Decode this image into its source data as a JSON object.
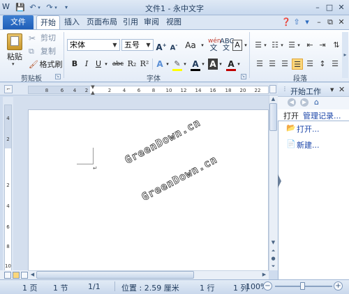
{
  "window": {
    "title": "文件1 - 永中文字",
    "app_icon_letter": "W"
  },
  "quick_access": {
    "save_icon": "save-icon",
    "undo_icon": "undo-icon",
    "redo_icon": "redo-icon"
  },
  "tabs": {
    "file": "文件",
    "items": [
      "开始",
      "插入",
      "页面布局",
      "引用",
      "审阅",
      "视图"
    ],
    "active": "开始"
  },
  "clipboard": {
    "paste_label": "粘贴",
    "cut_label": "剪切",
    "copy_label": "复制",
    "format_painter_label": "格式刷",
    "group_label": "剪贴板"
  },
  "font": {
    "font_name": "宋体",
    "font_size": "五号",
    "group_label": "字体",
    "aa_label": "Aa",
    "bold": "B",
    "italic": "I",
    "underline": "U",
    "strike": "abc",
    "subscript": "R₂",
    "superscript": "R²",
    "color_a": "A"
  },
  "paragraph": {
    "group_label": "段落"
  },
  "ruler": {
    "ticks": [
      "8",
      "6",
      "4",
      "2",
      "",
      "2",
      "4",
      "6",
      "8",
      "10",
      "12",
      "14",
      "16",
      "18",
      "20",
      "22"
    ],
    "vticks": [
      "4",
      "2",
      "",
      "2",
      "4",
      "6",
      "8",
      "10"
    ]
  },
  "watermark": [
    "GreenDown.cn",
    "GreenDown.cn"
  ],
  "side_pane": {
    "title": "开始工作",
    "tab_open": "打开",
    "tab_history": "管理记录...",
    "open_link": "打开...",
    "new_link": "新建..."
  },
  "status": {
    "page": "1 页",
    "section": "1 节",
    "pages": "1/1",
    "position": "位置 : 2.59 厘米",
    "line": "1 行",
    "column": "1 列",
    "zoom": "100%"
  },
  "colors": {
    "accent": "#2b579a",
    "file_tab": "#1f5eb8",
    "link": "#1a44a8"
  }
}
